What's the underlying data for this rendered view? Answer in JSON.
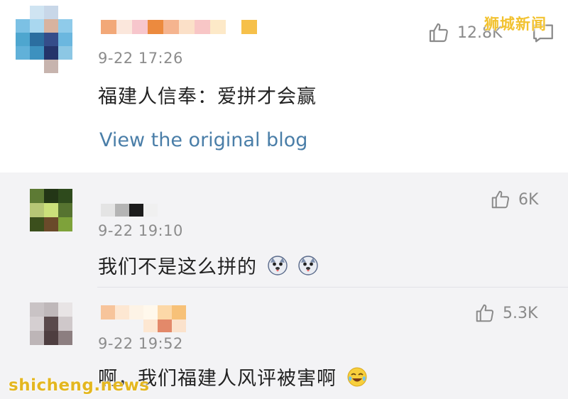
{
  "watermark_top": "狮城新闻",
  "watermark_bottom": "shicheng.news",
  "comments": [
    {
      "time": "9-22 17:26",
      "text": "福建人信奉：爱拼才会赢",
      "likes": "12.8K",
      "link": "View the original blog"
    },
    {
      "time": "9-22 19:10",
      "text": "我们不是这么拼的",
      "likes": "6K",
      "emoji": "doge-emoji"
    },
    {
      "time": "9-22 19:52",
      "text": "啊，我们福建人风评被害啊",
      "likes": "5.3K",
      "emoji": "laughing-crying-emoji"
    }
  ],
  "colors": {
    "link": "#4a7ea8",
    "meta": "#8c8c8c",
    "reply_bg": "#f3f3f5",
    "watermark": "#f2c230"
  }
}
